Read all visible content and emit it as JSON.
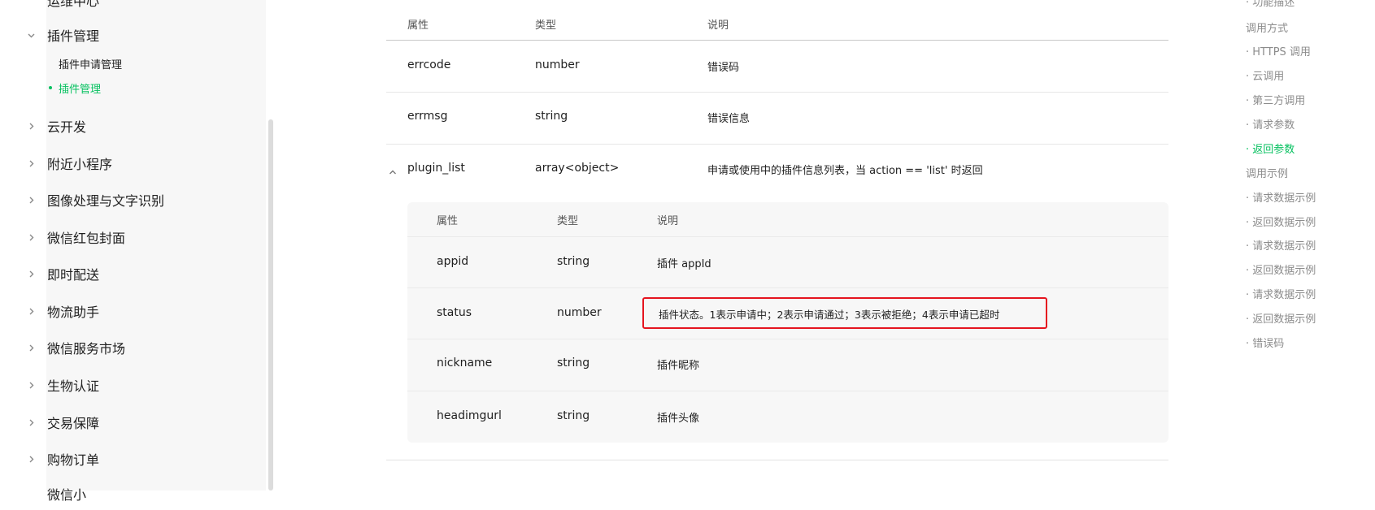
{
  "sidebar": {
    "partial_top_label": "运维中心",
    "plugin_mgmt": "插件管理",
    "sub_items": [
      "插件申请管理",
      "插件管理"
    ],
    "sections": [
      "云开发",
      "附近小程序",
      "图像处理与文字识别",
      "微信红包封面",
      "即时配送",
      "物流助手",
      "微信服务市场",
      "生物认证",
      "交易保障",
      "购物订单"
    ],
    "partial_bottom_label": "微信小"
  },
  "table": {
    "headers": [
      "属性",
      "类型",
      "说明"
    ],
    "rows": [
      {
        "name": "errcode",
        "type": "number",
        "desc": "错误码"
      },
      {
        "name": "errmsg",
        "type": "string",
        "desc": "错误信息"
      },
      {
        "name": "plugin_list",
        "type": "array<object>",
        "desc": "申请或使用中的插件信息列表，当 action == 'list' 时返回"
      }
    ],
    "nested_headers": [
      "属性",
      "类型",
      "说明"
    ],
    "nested_rows": [
      {
        "name": "appid",
        "type": "string",
        "desc": "插件 appId"
      },
      {
        "name": "status",
        "type": "number",
        "desc": "插件状态。1表示申请中；2表示申请通过；3表示被拒绝；4表示申请已超时"
      },
      {
        "name": "nickname",
        "type": "string",
        "desc": "插件昵称"
      },
      {
        "name": "headimgurl",
        "type": "string",
        "desc": "插件头像"
      }
    ]
  },
  "toc": {
    "partial_top": "· 功能描述",
    "items": [
      {
        "label": "调用方式",
        "level": "top"
      },
      {
        "label": "· HTTPS 调用",
        "level": "sub"
      },
      {
        "label": "· 云调用",
        "level": "sub"
      },
      {
        "label": "· 第三方调用",
        "level": "sub"
      },
      {
        "label": "· 请求参数",
        "level": "sub"
      },
      {
        "label": "· 返回参数",
        "level": "sub",
        "active": true
      },
      {
        "label": "调用示例",
        "level": "top"
      },
      {
        "label": "· 请求数据示例",
        "level": "sub"
      },
      {
        "label": "· 返回数据示例",
        "level": "sub"
      },
      {
        "label": "· 请求数据示例",
        "level": "sub"
      },
      {
        "label": "· 返回数据示例",
        "level": "sub"
      },
      {
        "label": "· 请求数据示例",
        "level": "sub"
      },
      {
        "label": "· 返回数据示例",
        "level": "sub"
      },
      {
        "label": "· 错误码",
        "level": "sub"
      }
    ]
  },
  "colors": {
    "accent": "#07c160",
    "highlight_border": "#e5141f"
  }
}
